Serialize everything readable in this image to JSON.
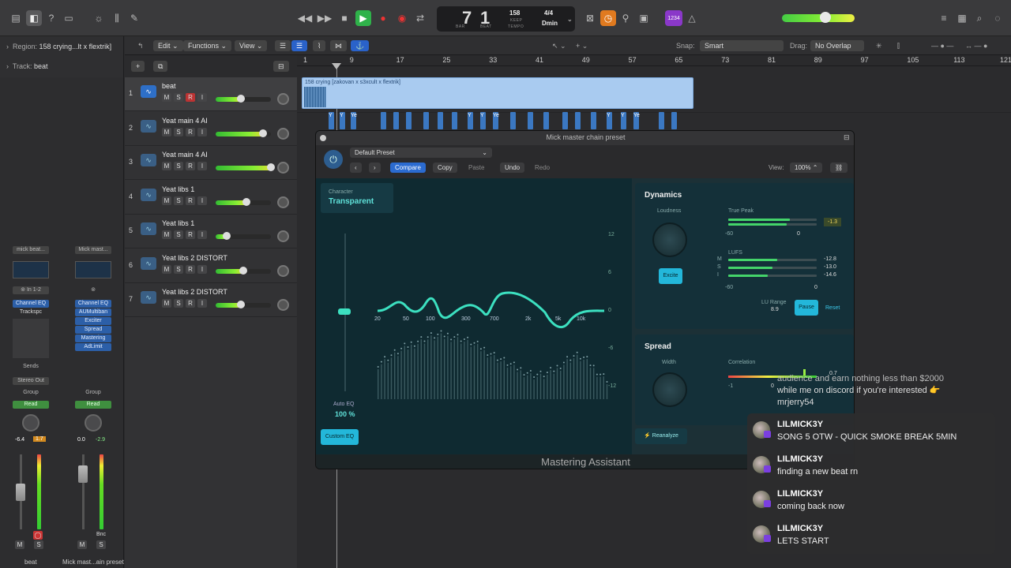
{
  "lcd": {
    "bar": "7",
    "beat": "1",
    "bar_caption": "BAR",
    "beat_caption": "BEAT",
    "tempo": "158",
    "tempo_caption_top": "KEEP",
    "tempo_caption": "TEMPO",
    "signature": "4/4",
    "key": "Dmin",
    "badge": "1234"
  },
  "info": {
    "region_label": "Region:",
    "region_value": "158 crying...lt x flextrik]",
    "track_label": "Track:",
    "track_value": "beat"
  },
  "toolbar": {
    "edit": "Edit",
    "functions": "Functions",
    "view": "View",
    "snap_label": "Snap:",
    "snap_value": "Smart",
    "drag_label": "Drag:",
    "drag_value": "No Overlap"
  },
  "ruler": [
    "1",
    "9",
    "17",
    "25",
    "33",
    "41",
    "49",
    "57",
    "65",
    "73",
    "81",
    "89",
    "97",
    "105",
    "113",
    "121"
  ],
  "tracks": [
    {
      "num": "1",
      "name": "beat",
      "vol": 0.45,
      "sel": true
    },
    {
      "num": "2",
      "name": "Yeat main 4 AI",
      "vol": 0.85,
      "sel": false
    },
    {
      "num": "3",
      "name": "Yeat main 4 AI",
      "vol": 1.0,
      "sel": false
    },
    {
      "num": "4",
      "name": "Yeat libs 1",
      "vol": 0.55,
      "sel": false
    },
    {
      "num": "5",
      "name": "Yeat libs 1",
      "vol": 0.2,
      "sel": false
    },
    {
      "num": "6",
      "name": "Yeat libs 2 DISTORT",
      "vol": 0.5,
      "sel": false
    },
    {
      "num": "7",
      "name": "Yeat libs 2 DISTORT",
      "vol": 0.45,
      "sel": false
    }
  ],
  "track_buttons": {
    "m": "M",
    "s": "S",
    "r": "R",
    "i": "I"
  },
  "region": {
    "name": "158 crying [zakovan x s3xcult x flextrik]"
  },
  "lane_labels": [
    "Y",
    "Y",
    "Ye",
    "Y",
    "Y",
    "Ye",
    "Y",
    "Y",
    "Ye"
  ],
  "inspector": {
    "left": {
      "setting": "mick beat...",
      "input": "In 1-2",
      "fx": [
        "Channel EQ",
        "Trackspc"
      ],
      "sends": "Sends",
      "output": "Stereo Out",
      "group": "Group",
      "automation": "Read",
      "vol": "-6.4",
      "peak": "1.7",
      "m": "M",
      "s": "S",
      "name": "beat"
    },
    "right": {
      "setting": "Mick mast...",
      "fx": [
        "Channel EQ",
        "AUMultiban",
        "Exciter",
        "Spread",
        "Mastering",
        "AdLimit"
      ],
      "group": "Group",
      "automation": "Read",
      "vol": "0.0",
      "peak": "-2.9",
      "bnc": "Bnc",
      "m": "M",
      "s": "S",
      "name": "Mick mast...ain preset"
    }
  },
  "plugin": {
    "title": "Mick master chain preset",
    "preset": "Default Preset",
    "compare": "Compare",
    "copy": "Copy",
    "paste": "Paste",
    "undo": "Undo",
    "redo": "Redo",
    "view_label": "View:",
    "view_value": "100%",
    "character_label": "Character",
    "character_value": "Transparent",
    "eq_db_ticks": [
      "12",
      "6",
      "0",
      "-6",
      "-12"
    ],
    "eq_freq_ticks": [
      "20",
      "50",
      "100",
      "300",
      "700",
      "2k",
      "5k",
      "10k"
    ],
    "auto_eq_label": "Auto EQ",
    "auto_eq_value": "100 %",
    "custom_eq": "Custom EQ",
    "dynamics_title": "Dynamics",
    "loudness_label": "Loudness",
    "excite": "Excite",
    "true_peak_label": "True Peak",
    "true_peak_value": "-1.3",
    "tp_scale_min": "-60",
    "tp_scale_zero": "0",
    "lufs_label": "LUFS",
    "lufs": [
      {
        "ch": "M",
        "value": "-12.8",
        "fill": 0.55
      },
      {
        "ch": "S",
        "value": "-13.0",
        "fill": 0.5
      },
      {
        "ch": "I",
        "value": "-14.6",
        "fill": 0.45
      }
    ],
    "lufs_scale_min": "-60",
    "lufs_scale_zero": "0",
    "lu_range_label": "LU Range",
    "lu_range_value": "8.9",
    "pause": "Pause",
    "reset": "Reset",
    "spread_title": "Spread",
    "width_label": "Width",
    "correlation_label": "Correlation",
    "corr_min": "-1",
    "corr_zero": "0",
    "corr_value": "0.7",
    "reanalyze": "Reanalyze",
    "footer": "Mastering Assistant"
  },
  "chat": {
    "partial": [
      "audience and earn nothing less than $2000",
      "while me on discord if you're interested 👉",
      "mrjerry54"
    ],
    "messages": [
      {
        "user": "LILMICK3Y",
        "text": "SONG 5 OTW - QUICK SMOKE BREAK 5MIN"
      },
      {
        "user": "LILMICK3Y",
        "text": "finding a new beat rn"
      },
      {
        "user": "LILMICK3Y",
        "text": "coming back now"
      },
      {
        "user": "LILMICK3Y",
        "text": "LETS START"
      }
    ]
  }
}
